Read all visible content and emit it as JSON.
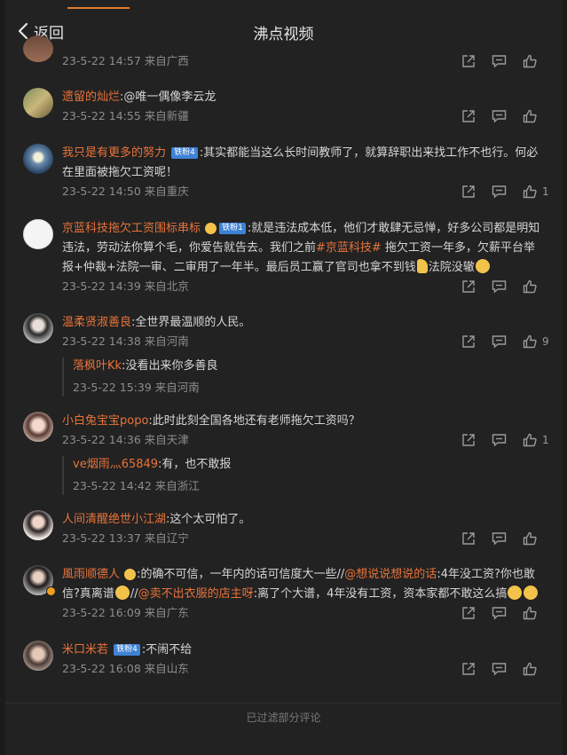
{
  "header": {
    "back_label": "返回",
    "title": "沸点视频"
  },
  "colors": {
    "accent": "#e8733a",
    "background": "#222222",
    "muted": "#8d8d8d",
    "level_badge": "#3e82d6"
  },
  "comments": [
    {
      "id": 0,
      "meta": "23-5-22 14:57 来自广西",
      "like_count": ""
    },
    {
      "id": 1,
      "username": "遗留的灿烂",
      "text": ":@唯一偶像李云龙",
      "meta": "23-5-22 14:55 来自新疆",
      "like_count": ""
    },
    {
      "id": 2,
      "username": "我只是有更多的努力",
      "level": "铁粉4",
      "text": ":其实都能当这么长时间教师了，就算辞职出来找工作不也行。何必在里面被拖欠工资呢！",
      "meta": "23-5-22 14:50 来自重庆",
      "like_count": "1"
    },
    {
      "id": 3,
      "username": "京蓝科技拖欠工资围标串标",
      "level": "铁粉1",
      "text_a": ":就是违法成本低，他们才敢肆无忌惮，好多公司都是明知违法，劳动法你算个毛，你爱告就告去。我们之前",
      "topic": "#京蓝科技#",
      "text_b": " 拖欠工资一年多，欠薪平台举报+仲裁+法院一审、二审用了一年半。最后员工赢了官司也拿不到钱",
      "text_c": "法院没辙",
      "meta": "23-5-22 14:39 来自北京",
      "like_count": ""
    },
    {
      "id": 4,
      "username": "温柔贤淑善良",
      "text": ":全世界最温顺的人民。",
      "meta": "23-5-22 14:38 来自河南",
      "like_count": "9",
      "reply": {
        "username": "落枫叶Kk",
        "text": ":没看出来你多善良",
        "meta": "23-5-22 15:39 来自河南"
      }
    },
    {
      "id": 5,
      "username": "小白兔宝宝popo",
      "text": ":此时此刻全国各地还有老师拖欠工资吗？",
      "meta": "23-5-22 14:36 来自天津",
      "like_count": "1",
      "reply": {
        "username": "ve烟雨灬65849",
        "text": ":有，也不敢报",
        "meta": "23-5-22 14:42 来自浙江"
      }
    },
    {
      "id": 6,
      "username": "人间清醒绝世小江湖",
      "text": ":这个太可怕了。",
      "meta": "23-5-22 13:37 来自辽宁",
      "like_count": ""
    },
    {
      "id": 7,
      "username": "風雨顺德人",
      "text_a": ":的确不可信，一年内的话可信度大一些//",
      "mention_a": "@想说说想说的话",
      "text_b": ":4年没工资?你也敢信?真离谱",
      "text_c": "//",
      "mention_b": "@卖不出衣服的店主呀",
      "text_d": ":离了个大谱，4年没有工资，资本家都不敢这么搞",
      "meta": "23-5-22 16:09 来自广东",
      "like_count": ""
    },
    {
      "id": 8,
      "username": "米口米若",
      "level": "铁粉4",
      "text": ":不闹不给",
      "meta": "23-5-22 16:08 来自山东",
      "like_count": ""
    }
  ],
  "footer": {
    "filtered_note": "已过滤部分评论"
  }
}
